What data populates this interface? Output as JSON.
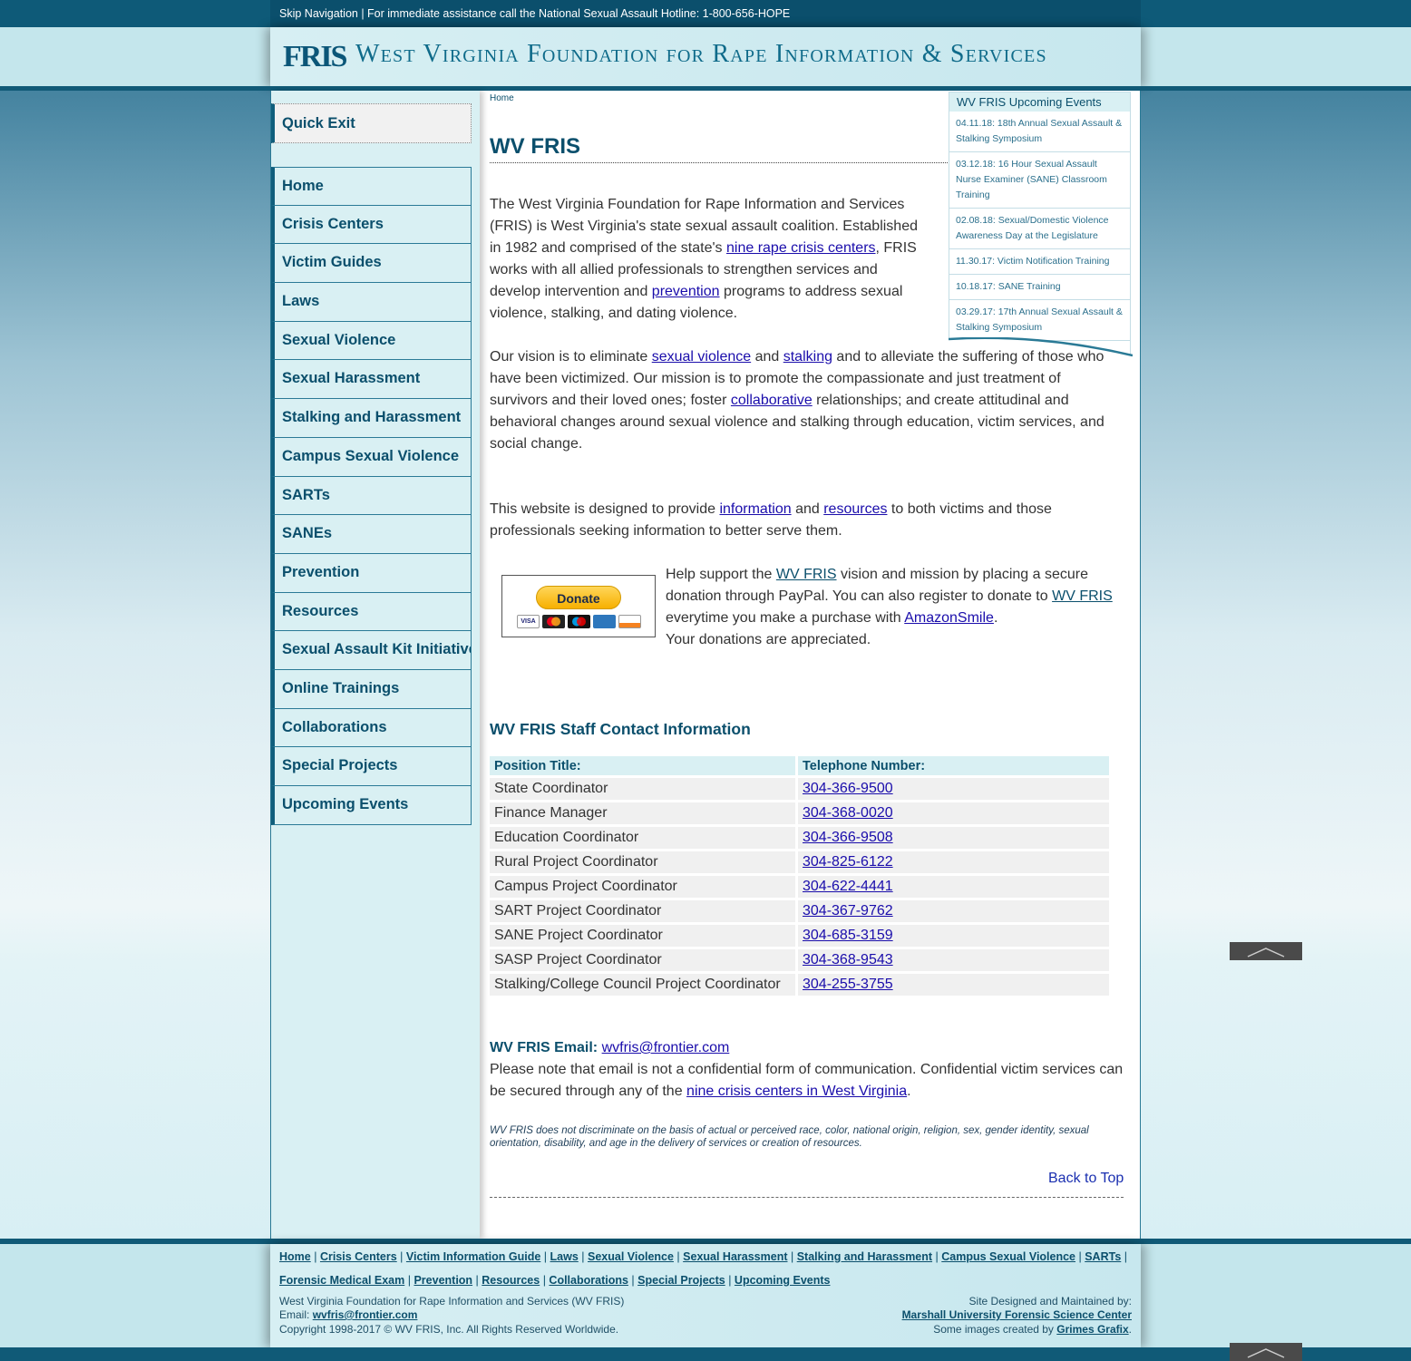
{
  "topbar": {
    "text": "Skip Navigation | For immediate assistance call the National Sexual Assault Hotline: 1-800-656-HOPE"
  },
  "header": {
    "logo": "FRIS",
    "title": "West Virginia Foundation for Rape Information & Services"
  },
  "sidebar": {
    "quick_exit": "Quick Exit",
    "items": [
      {
        "label": "Home"
      },
      {
        "label": "Crisis Centers"
      },
      {
        "label": "Victim Guides"
      },
      {
        "label": "Laws"
      },
      {
        "label": "Sexual Violence"
      },
      {
        "label": "Sexual Harassment"
      },
      {
        "label": "Stalking and Harassment"
      },
      {
        "label": "Campus Sexual Violence"
      },
      {
        "label": "SARTs"
      },
      {
        "label": "SANEs"
      },
      {
        "label": "Prevention"
      },
      {
        "label": "Resources"
      },
      {
        "label": "Sexual Assault Kit Initiative"
      },
      {
        "label": "Online Trainings"
      },
      {
        "label": "Collaborations"
      },
      {
        "label": "Special Projects"
      },
      {
        "label": "Upcoming Events"
      }
    ]
  },
  "main": {
    "breadcrumb": "Home",
    "title": "WV FRIS",
    "intro": {
      "p1_a": "The West Virginia Foundation for Rape Information and Services (FRIS) is West Virginia's state sexual assault coalition. Established in 1982 and comprised of the state's ",
      "p1_link1": "nine rape crisis centers",
      "p1_b": ", FRIS works with all allied professionals to strengthen services and develop intervention and ",
      "p1_link2": "prevention",
      "p1_c": " programs to address sexual violence, stalking, and dating violence.",
      "p2_a": "Our vision is to eliminate ",
      "p2_link1": "sexual violence",
      "p2_b": " and ",
      "p2_link2": "stalking",
      "p2_c": " and to alleviate the suffering of those who have been victimized. Our mission is to promote the compassionate and just treatment of survivors and their loved ones; foster ",
      "p2_link3": "collaborative",
      "p2_d": " relationships; and create attitudinal and behavioral changes around sexual violence and stalking through education, victim services, and social change.",
      "p3_a": "This website is designed to provide ",
      "p3_link1": "information",
      "p3_b": " and ",
      "p3_link2": "resources",
      "p3_c": " to both victims and those professionals seeking information to better serve them."
    },
    "donate": {
      "button": "Donate",
      "cards": [
        "VISA",
        "MC",
        "MAESTRO",
        "AMEX",
        "DISCOVER"
      ],
      "text_a": "Help support the ",
      "link1": "WV FRIS",
      "text_b": " vision and mission by placing a secure donation through PayPal. You can also register to donate to ",
      "link2": "WV FRIS",
      "text_c": " everytime you make a purchase with ",
      "link3": "AmazonSmile",
      "text_d": ".",
      "thanks": "Your donations are appreciated."
    },
    "staff": {
      "heading": "WV FRIS Staff Contact Information",
      "col1": "Position Title:",
      "col2": "Telephone Number:",
      "rows": [
        {
          "title": "State Coordinator",
          "phone": "304-366-9500"
        },
        {
          "title": "Finance Manager",
          "phone": "304-368-0020"
        },
        {
          "title": "Education Coordinator",
          "phone": "304-366-9508"
        },
        {
          "title": "Rural Project Coordinator",
          "phone": "304-825-6122"
        },
        {
          "title": "Campus Project Coordinator",
          "phone": "304-622-4441"
        },
        {
          "title": "SART Project Coordinator",
          "phone": "304-367-9762"
        },
        {
          "title": "SANE Project Coordinator",
          "phone": "304-685-3159"
        },
        {
          "title": "SASP Project Coordinator",
          "phone": "304-368-9543"
        },
        {
          "title": "Stalking/College Council Project Coordinator",
          "phone": "304-255-3755"
        }
      ]
    },
    "email": {
      "label": "WV FRIS Email:",
      "address": "wvfris@frontier.com",
      "note_a": "Please note that email is not a confidential form of communication. Confidential victim services can be secured through any of the ",
      "note_link": "nine crisis centers in West Virginia",
      "note_b": "."
    },
    "disclaimer": "WV FRIS does not discriminate on the basis of actual or perceived race, color, national origin, religion, sex, gender identity, sexual orientation, disability, and age in the delivery of services or creation of resources.",
    "back_to_top": "Back to Top"
  },
  "events": {
    "title": "WV FRIS Upcoming Events",
    "items": [
      {
        "label": "04.11.18: 18th Annual Sexual Assault & Stalking Symposium"
      },
      {
        "label": "03.12.18: 16 Hour Sexual Assault Nurse Examiner (SANE) Classroom Training"
      },
      {
        "label": "02.08.18: Sexual/Domestic Violence Awareness Day at the Legislature"
      },
      {
        "label": "11.30.17: Victim Notification Training"
      },
      {
        "label": "10.18.17: SANE Training"
      },
      {
        "label": "03.29.17: 17th Annual Sexual Assault & Stalking Symposium"
      }
    ]
  },
  "footer": {
    "row1": [
      "Home",
      "Crisis Centers",
      "Victim Information Guide",
      "Laws",
      "Sexual Violence",
      "Sexual Harassment",
      "Stalking and Harassment",
      "Campus Sexual Violence",
      "SARTs"
    ],
    "row2": [
      "Forensic Medical Exam",
      "Prevention",
      "Resources",
      "Collaborations",
      "Special Projects",
      "Upcoming Events"
    ],
    "org": "West Virginia Foundation for Rape Information and Services (WV FRIS)",
    "email_label": "Email: ",
    "email": "wvfris@frontier.com",
    "copyright": "Copyright 1998-2017 © WV FRIS, Inc. All Rights Reserved Worldwide.",
    "designed": "Site Designed and Maintained by:",
    "designer": "Marshall University Forensic Science Center",
    "images_a": "Some images created by ",
    "images_link": "Grimes Grafix",
    "images_b": "."
  },
  "colors": {
    "accent": "#0b4f6c",
    "nav_bg": "#d9f0f3",
    "link": "#1a0dab"
  }
}
